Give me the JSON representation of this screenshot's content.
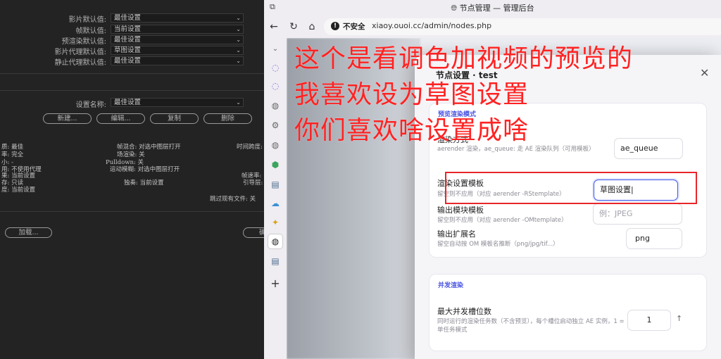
{
  "ae_panel": {
    "defaults": [
      {
        "label": "影片默认值:",
        "value": "最佳设置"
      },
      {
        "label": "帧默认值:",
        "value": "当前设置"
      },
      {
        "label": "预渲染默认值:",
        "value": "最佳设置"
      },
      {
        "label": "影片代理默认值:",
        "value": "草图设置"
      },
      {
        "label": "静止代理默认值:",
        "value": "最佳设置"
      }
    ],
    "settings_name_label": "设置名称:",
    "settings_name_value": "最佳设置",
    "buttons": {
      "new": "新建...",
      "edit": "编辑...",
      "duplicate": "复制",
      "delete": "删除",
      "load": "加载..."
    },
    "details": {
      "col1": [
        "质: 最佳",
        "率: 完全",
        "小: -",
        "用: 不使用代理",
        "果: 当前设置",
        "存: 只读",
        "度: 当前设置"
      ],
      "col2": [
        "帧混合: 对选中图层打开",
        "场渲染: 关",
        "Pulldown: 关",
        "运动模糊: 对选中图层打开",
        "",
        "独奏: 当前设置"
      ],
      "col3": [
        "时间跨度:",
        "帧速率:",
        "引导层:",
        "跳过现有文件: 关"
      ]
    },
    "edge_button_glyph": "确"
  },
  "browser": {
    "window_title": "节点管理 — 管理后台",
    "security_label": "不安全",
    "url": "xiaoy.ouoi.cc/admin/nodes.php",
    "modal": {
      "title": "节点设置 · test",
      "render_section": {
        "header": "预览渲染模式",
        "render_method": {
          "label": "渲染方式",
          "help": "aerender 渲染，ae_queue: 走 AE 渲染队列（可用模板）",
          "value": "ae_queue"
        },
        "render_template": {
          "label": "渲染设置模板",
          "help": "留空则不应用（对应 aerender -RStemplate）",
          "value": "草图设置"
        },
        "output_template": {
          "label": "输出模块模板",
          "help": "留空则不应用（对应 aerender -OMtemplate）",
          "placeholder": "例：JPEG"
        },
        "output_ext": {
          "label": "输出扩展名",
          "help": "留空自动按 OM 模板名推断（png/jpg/tif...）",
          "value": "png"
        }
      },
      "concurrency_section": {
        "header": "并发渲染",
        "max_slots": {
          "label": "最大并发槽位数",
          "help1": "同时运行的渲染任务数（不含预览），每个槽位启动独立 AE 实例，1 =",
          "help2": "单任务模式",
          "value": "1"
        }
      }
    }
  },
  "annotation": {
    "lines": [
      "这个是看调色加视频的预览的",
      "我喜欢设为草图设置",
      "你们喜欢啥设置成啥"
    ],
    "color": "#ff2222"
  }
}
